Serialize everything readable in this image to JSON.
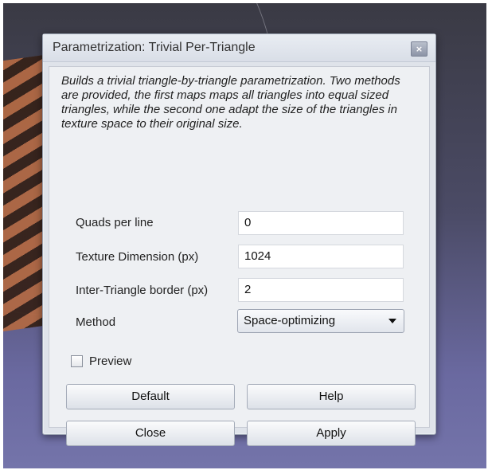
{
  "dialog": {
    "title": "Parametrization: Trivial Per-Triangle",
    "close_symbol": "×",
    "description": "Builds a trivial triangle-by-triangle parametrization. Two methods are provided, the first maps maps all triangles into equal sized triangles, while the second one adapt the size of the triangles in texture space to their original size."
  },
  "form": {
    "quads_per_line": {
      "label": "Quads per line",
      "value": "0"
    },
    "texture_dimension": {
      "label": "Texture Dimension (px)",
      "value": "1024"
    },
    "inter_triangle_border": {
      "label": "Inter-Triangle border (px)",
      "value": "2"
    },
    "method": {
      "label": "Method",
      "selected": "Space-optimizing"
    }
  },
  "preview": {
    "label": "Preview",
    "checked": false
  },
  "buttons": {
    "default": "Default",
    "help": "Help",
    "close": "Close",
    "apply": "Apply"
  },
  "icons": {
    "close": "close-icon",
    "dropdown": "chevron-down-icon"
  }
}
